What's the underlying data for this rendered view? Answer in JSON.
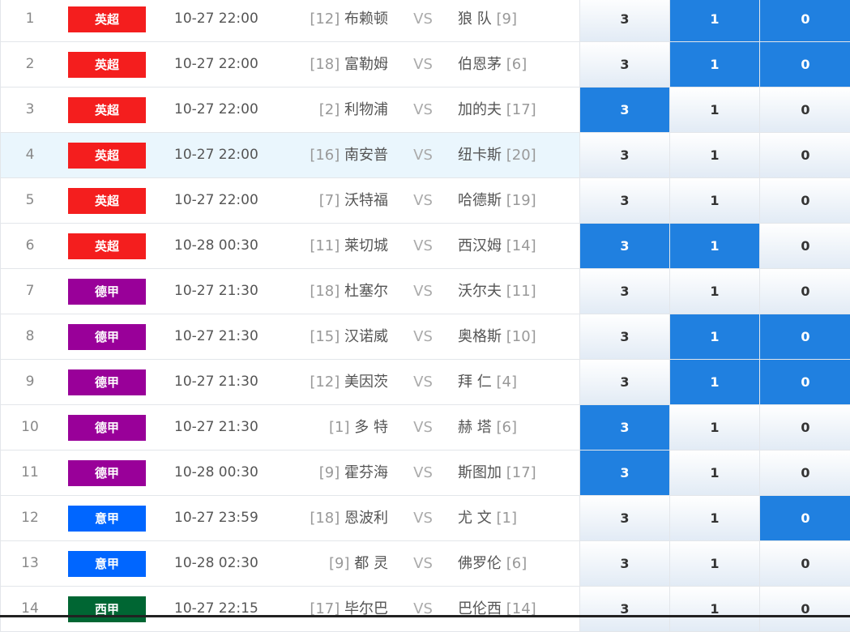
{
  "colors": {
    "league_premier": "#f41e1e",
    "league_bundesliga": "#990099",
    "league_seriea": "#0066ff",
    "league_laliga": "#006633",
    "selected_odd": "#2080e0",
    "highlight_row": "#eaf6fd"
  },
  "vs_text": "VS",
  "rows": [
    {
      "idx": "1",
      "league": "英超",
      "league_color": "#f41e1e",
      "time": "10-27 22:00",
      "home_rank": "[12]",
      "home": "布赖顿",
      "away": "狼 队",
      "away_rank": "[9]",
      "odds": [
        "3",
        "1",
        "0"
      ],
      "selected": [
        false,
        true,
        true
      ],
      "highlight": false
    },
    {
      "idx": "2",
      "league": "英超",
      "league_color": "#f41e1e",
      "time": "10-27 22:00",
      "home_rank": "[18]",
      "home": "富勒姆",
      "away": "伯恩茅",
      "away_rank": "[6]",
      "odds": [
        "3",
        "1",
        "0"
      ],
      "selected": [
        false,
        true,
        true
      ],
      "highlight": false
    },
    {
      "idx": "3",
      "league": "英超",
      "league_color": "#f41e1e",
      "time": "10-27 22:00",
      "home_rank": "[2]",
      "home": "利物浦",
      "away": "加的夫",
      "away_rank": "[17]",
      "odds": [
        "3",
        "1",
        "0"
      ],
      "selected": [
        true,
        false,
        false
      ],
      "highlight": false
    },
    {
      "idx": "4",
      "league": "英超",
      "league_color": "#f41e1e",
      "time": "10-27 22:00",
      "home_rank": "[16]",
      "home": "南安普",
      "away": "纽卡斯",
      "away_rank": "[20]",
      "odds": [
        "3",
        "1",
        "0"
      ],
      "selected": [
        false,
        false,
        false
      ],
      "highlight": true
    },
    {
      "idx": "5",
      "league": "英超",
      "league_color": "#f41e1e",
      "time": "10-27 22:00",
      "home_rank": "[7]",
      "home": "沃特福",
      "away": "哈德斯",
      "away_rank": "[19]",
      "odds": [
        "3",
        "1",
        "0"
      ],
      "selected": [
        false,
        false,
        false
      ],
      "highlight": false
    },
    {
      "idx": "6",
      "league": "英超",
      "league_color": "#f41e1e",
      "time": "10-28 00:30",
      "home_rank": "[11]",
      "home": "莱切城",
      "away": "西汉姆",
      "away_rank": "[14]",
      "odds": [
        "3",
        "1",
        "0"
      ],
      "selected": [
        true,
        true,
        false
      ],
      "highlight": false
    },
    {
      "idx": "7",
      "league": "德甲",
      "league_color": "#990099",
      "time": "10-27 21:30",
      "home_rank": "[18]",
      "home": "杜塞尔",
      "away": "沃尔夫",
      "away_rank": "[11]",
      "odds": [
        "3",
        "1",
        "0"
      ],
      "selected": [
        false,
        false,
        false
      ],
      "highlight": false
    },
    {
      "idx": "8",
      "league": "德甲",
      "league_color": "#990099",
      "time": "10-27 21:30",
      "home_rank": "[15]",
      "home": "汉诺威",
      "away": "奥格斯",
      "away_rank": "[10]",
      "odds": [
        "3",
        "1",
        "0"
      ],
      "selected": [
        false,
        true,
        true
      ],
      "highlight": false
    },
    {
      "idx": "9",
      "league": "德甲",
      "league_color": "#990099",
      "time": "10-27 21:30",
      "home_rank": "[12]",
      "home": "美因茨",
      "away": "拜 仁",
      "away_rank": "[4]",
      "odds": [
        "3",
        "1",
        "0"
      ],
      "selected": [
        false,
        true,
        true
      ],
      "highlight": false
    },
    {
      "idx": "10",
      "league": "德甲",
      "league_color": "#990099",
      "time": "10-27 21:30",
      "home_rank": "[1]",
      "home": "多 特",
      "away": "赫 塔",
      "away_rank": "[6]",
      "odds": [
        "3",
        "1",
        "0"
      ],
      "selected": [
        true,
        false,
        false
      ],
      "highlight": false
    },
    {
      "idx": "11",
      "league": "德甲",
      "league_color": "#990099",
      "time": "10-28 00:30",
      "home_rank": "[9]",
      "home": "霍芬海",
      "away": "斯图加",
      "away_rank": "[17]",
      "odds": [
        "3",
        "1",
        "0"
      ],
      "selected": [
        true,
        false,
        false
      ],
      "highlight": false
    },
    {
      "idx": "12",
      "league": "意甲",
      "league_color": "#0066ff",
      "time": "10-27 23:59",
      "home_rank": "[18]",
      "home": "恩波利",
      "away": "尤 文",
      "away_rank": "[1]",
      "odds": [
        "3",
        "1",
        "0"
      ],
      "selected": [
        false,
        false,
        true
      ],
      "highlight": false
    },
    {
      "idx": "13",
      "league": "意甲",
      "league_color": "#0066ff",
      "time": "10-28 02:30",
      "home_rank": "[9]",
      "home": "都 灵",
      "away": "佛罗伦",
      "away_rank": "[6]",
      "odds": [
        "3",
        "1",
        "0"
      ],
      "selected": [
        false,
        false,
        false
      ],
      "highlight": false
    },
    {
      "idx": "14",
      "league": "西甲",
      "league_color": "#006633",
      "time": "10-27 22:15",
      "home_rank": "[17]",
      "home": "毕尔巴",
      "away": "巴伦西",
      "away_rank": "[14]",
      "odds": [
        "3",
        "1",
        "0"
      ],
      "selected": [
        false,
        false,
        false
      ],
      "highlight": false
    }
  ]
}
